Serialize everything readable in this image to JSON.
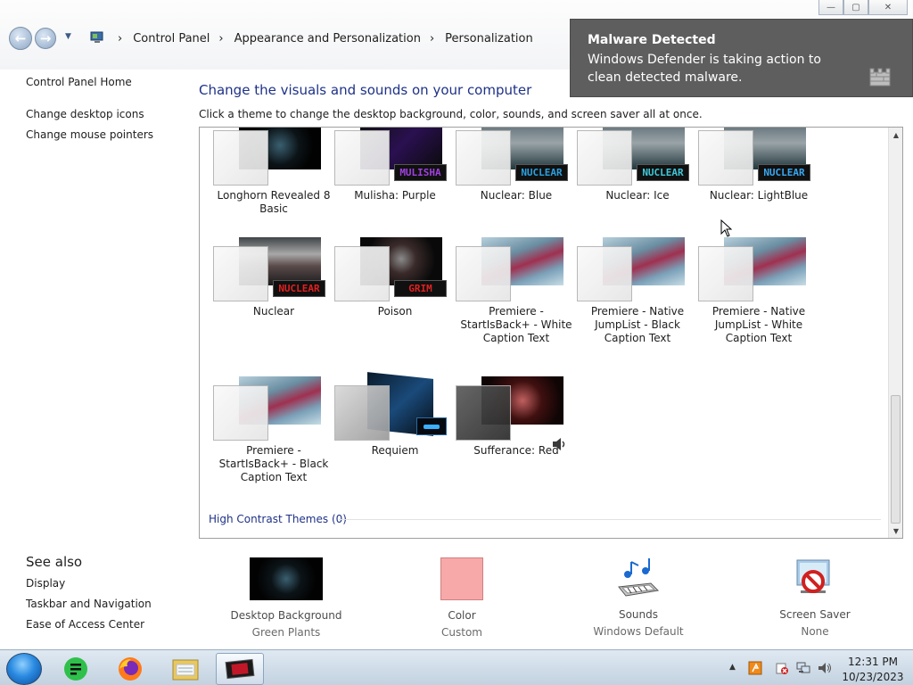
{
  "breadcrumb": {
    "items": [
      "Control Panel",
      "Appearance and Personalization",
      "Personalization"
    ]
  },
  "window_controls": {
    "minimize": "—",
    "maximize": "▢",
    "close": "✕"
  },
  "left_pane": {
    "home": "Control Panel Home",
    "links": [
      "Change desktop icons",
      "Change mouse pointers"
    ],
    "see_also_title": "See also",
    "see_also": [
      "Display",
      "Taskbar and Navigation",
      "Ease of Access Center"
    ]
  },
  "main": {
    "heading": "Change the visuals and sounds on your computer",
    "subheading": "Click a theme to change the desktop background, color, sounds, and screen saver all at once."
  },
  "themes": [
    {
      "name": "Longhorn Revealed 8 Basic",
      "badge": ""
    },
    {
      "name": "Mulisha: Purple",
      "badge": "MULISHA",
      "badge_color": "#a040e0"
    },
    {
      "name": "Nuclear: Blue",
      "badge": "NUCLEAR",
      "badge_color": "#2aa0e0"
    },
    {
      "name": "Nuclear: Ice",
      "badge": "NUCLEAR",
      "badge_color": "#40c8d8"
    },
    {
      "name": "Nuclear: LightBlue",
      "badge": "NUCLEAR",
      "badge_color": "#3aa8f0"
    },
    {
      "name": "Nuclear",
      "badge": "NUCLEAR",
      "badge_color": "#e02020"
    },
    {
      "name": "Poison",
      "badge": "GRIM",
      "badge_color": "#e02020"
    },
    {
      "name": "Premiere - StartIsBack+ - White Caption Text",
      "badge": ""
    },
    {
      "name": "Premiere - Native JumpList - Black Caption Text",
      "badge": ""
    },
    {
      "name": "Premiere - Native JumpList - White Caption Text",
      "badge": ""
    },
    {
      "name": "Premiere - StartIsBack+ - Black Caption Text",
      "badge": ""
    },
    {
      "name": "Requiem",
      "badge": ""
    },
    {
      "name": "Sufferance: Red",
      "badge": ""
    }
  ],
  "high_contrast": "High Contrast Themes (0)",
  "settings": [
    {
      "title": "Desktop Background",
      "value": "Green Plants"
    },
    {
      "title": "Color",
      "value": "Custom",
      "color": "#f7a8a8"
    },
    {
      "title": "Sounds",
      "value": "Windows Default"
    },
    {
      "title": "Screen Saver",
      "value": "None"
    }
  ],
  "toast": {
    "title": "Malware Detected",
    "message": "Windows Defender is taking action to clean detected malware."
  },
  "clock": {
    "time": "12:31 PM",
    "date": "10/23/2023"
  },
  "colors": {
    "link": "#1e3287",
    "toast_bg": "#5e5e5e",
    "accent": "#2a8ae0"
  }
}
